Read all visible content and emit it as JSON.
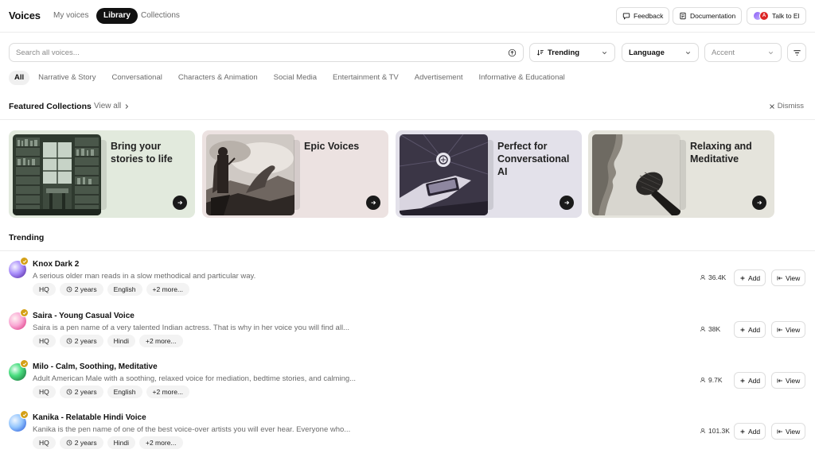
{
  "header": {
    "title": "Voices",
    "tabs": [
      {
        "label": "My voices",
        "active": false
      },
      {
        "label": "Library",
        "active": true
      },
      {
        "label": "Collections",
        "active": false
      }
    ],
    "feedback_label": "Feedback",
    "documentation_label": "Documentation",
    "talk_label": "Talk to El",
    "avatar_letter": "A"
  },
  "search": {
    "placeholder": "Search all voices...",
    "sort_label": "Trending",
    "language_label": "Language",
    "accent_label": "Accent"
  },
  "categories": [
    "All",
    "Narrative & Story",
    "Conversational",
    "Characters & Animation",
    "Social Media",
    "Entertainment & TV",
    "Advertisement",
    "Informative & Educational"
  ],
  "featured": {
    "title": "Featured Collections",
    "view_all": "View all",
    "dismiss": "Dismiss",
    "cards": [
      {
        "title": "Bring your stories to life",
        "bg": "#e2eadd"
      },
      {
        "title": "Epic Voices",
        "bg": "#ece2e1"
      },
      {
        "title": "Perfect for Conversational AI",
        "bg": "#e3e1ea"
      },
      {
        "title": "Relaxing and Meditative",
        "bg": "#e5e4dc"
      }
    ]
  },
  "trending": {
    "title": "Trending",
    "add_label": "Add",
    "view_label": "View",
    "voices": [
      {
        "name": "Knox Dark 2",
        "description": "A serious older man reads in a slow methodical and particular way.",
        "tags": [
          "HQ",
          "2 years",
          "English",
          "+2 more..."
        ],
        "uses": "36.4K"
      },
      {
        "name": "Saira - Young Casual Voice",
        "description": "Saira is a pen name of a very talented Indian actress. That is why in her voice you will find all...",
        "tags": [
          "HQ",
          "2 years",
          "Hindi",
          "+2 more..."
        ],
        "uses": "38K"
      },
      {
        "name": "Milo - Calm, Soothing, Meditative",
        "description": "Adult American Male with a soothing, relaxed voice for mediation, bedtime stories, and calming...",
        "tags": [
          "HQ",
          "2 years",
          "English",
          "+2 more..."
        ],
        "uses": "9.7K"
      },
      {
        "name": "Kanika - Relatable Hindi Voice",
        "description": "Kanika is the pen name of one of the best voice-over artists you will ever hear. Everyone who...",
        "tags": [
          "HQ",
          "2 years",
          "Hindi",
          "+2 more..."
        ],
        "uses": "101.3K"
      }
    ]
  }
}
